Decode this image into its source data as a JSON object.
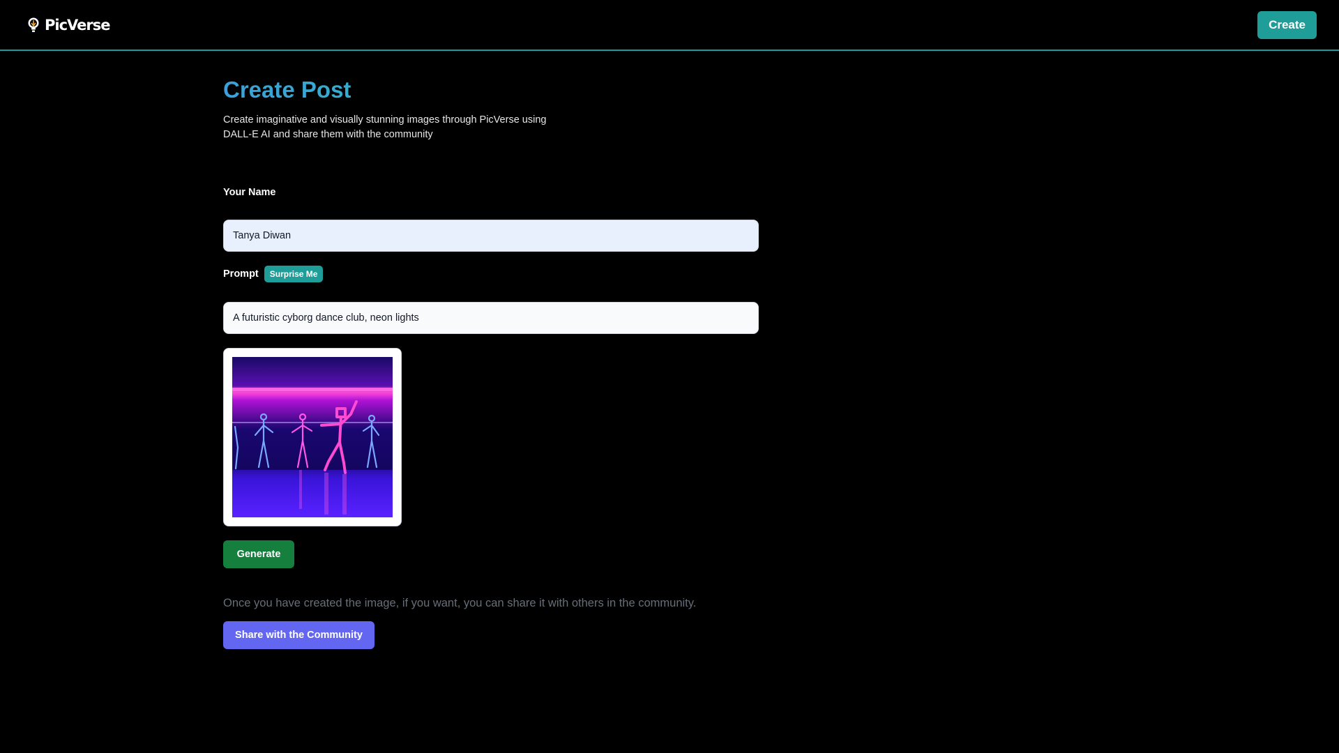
{
  "header": {
    "logo_text": "PicVerse",
    "logo_icon": "lightbulb-icon",
    "create_label": "Create"
  },
  "page": {
    "title_word_1": "Create",
    "title_word_2": "Post",
    "subtitle_line_1": "Create imaginative and visually stunning images through PicVerse using",
    "subtitle_line_2": "DALL-E AI and share them with the community"
  },
  "form": {
    "name_label": "Your Name",
    "name_value": "Tanya Diwan",
    "prompt_label": "Prompt",
    "surprise_label": "Surprise Me",
    "prompt_value": "A futuristic cyborg dance club, neon lights",
    "generate_label": "Generate"
  },
  "share": {
    "note": "Once you have created the image, if you want, you can share it with others in the community.",
    "button_label": "Share with the Community"
  },
  "colors": {
    "accent": "#1f9d98",
    "generate": "#15803d",
    "share": "#6366f1",
    "background": "#000000"
  }
}
